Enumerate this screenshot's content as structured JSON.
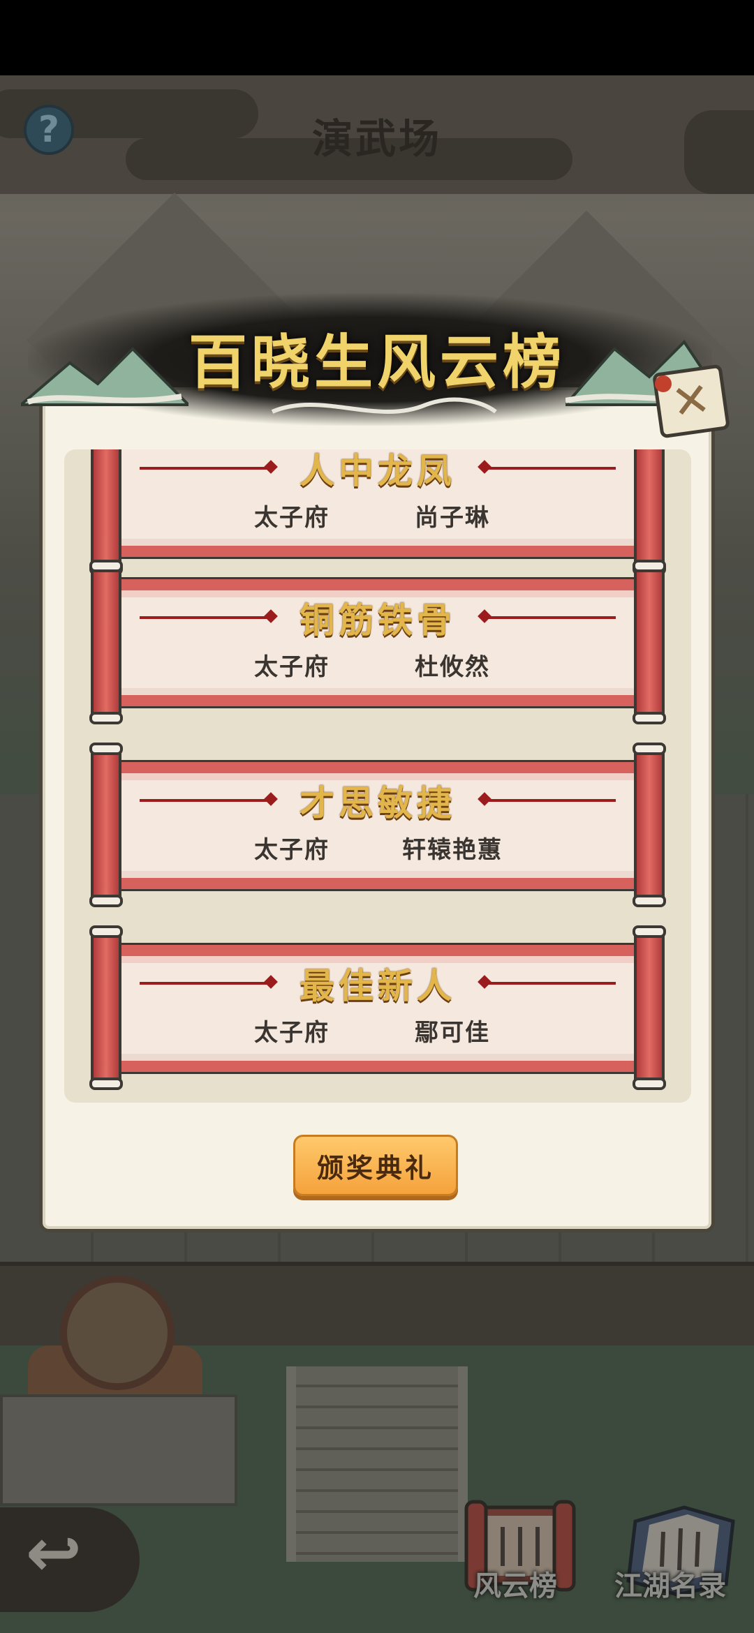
{
  "scene": {
    "title": "演武场",
    "help_icon": "question-mark",
    "back_icon": "back-arrow"
  },
  "bottom_nav": [
    {
      "label": "风云榜",
      "icon": "scroll-board-icon"
    },
    {
      "label": "江湖名录",
      "icon": "book-icon"
    }
  ],
  "modal": {
    "title": "百晓生风云榜",
    "close_icon": "close-x",
    "awards": [
      {
        "title": "人中龙凤",
        "org": "太子府",
        "winner": "尚子琳"
      },
      {
        "title": "铜筋铁骨",
        "org": "太子府",
        "winner": "杜攸然"
      },
      {
        "title": "才思敏捷",
        "org": "太子府",
        "winner": "轩辕艳蕙"
      },
      {
        "title": "最佳新人",
        "org": "太子府",
        "winner": "鄢可佳"
      }
    ],
    "ceremony_button": "颁奖典礼"
  },
  "colors": {
    "scroll_red": "#d7625d",
    "award_gold": "#e2b64a",
    "button_orange": "#f5a23c",
    "panel_cream": "#f6f3e6"
  }
}
